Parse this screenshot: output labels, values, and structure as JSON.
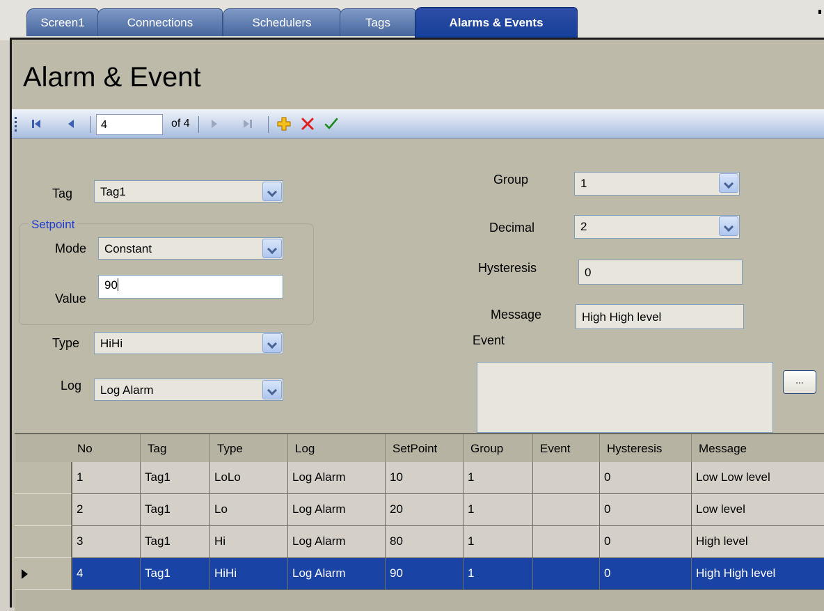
{
  "tabs": [
    {
      "label": "Screen1",
      "active": false
    },
    {
      "label": "Connections",
      "active": false
    },
    {
      "label": "Schedulers",
      "active": false
    },
    {
      "label": "Tags",
      "active": false
    },
    {
      "label": "Alarms & Events",
      "active": true
    }
  ],
  "page_title": "Alarm & Event",
  "navigator": {
    "position": "4",
    "count_text": "of 4",
    "icons": [
      "move-first-icon",
      "move-previous-icon",
      "move-next-icon",
      "move-last-icon",
      "add-new-icon",
      "delete-icon",
      "save-icon"
    ]
  },
  "form": {
    "tag": {
      "label": "Tag",
      "value": "Tag1"
    },
    "setpoint_legend": "Setpoint",
    "mode": {
      "label": "Mode",
      "value": "Constant"
    },
    "value": {
      "label": "Value",
      "value": "90"
    },
    "type": {
      "label": "Type",
      "value": "HiHi"
    },
    "log": {
      "label": "Log",
      "value": "Log Alarm"
    },
    "group": {
      "label": "Group",
      "value": "1"
    },
    "decimal": {
      "label": "Decimal",
      "value": "2"
    },
    "hysteresis": {
      "label": "Hysteresis",
      "value": "0"
    },
    "message": {
      "label": "Message",
      "value": "High High level"
    },
    "event": {
      "label": "Event",
      "value": "",
      "browse_label": "..."
    }
  },
  "grid": {
    "columns": [
      "No",
      "Tag",
      "Type",
      "Log",
      "SetPoint",
      "Group",
      "Event",
      "Hysteresis",
      "Message"
    ],
    "rows": [
      [
        "1",
        "Tag1",
        "LoLo",
        "Log Alarm",
        "10",
        "1",
        "",
        "0",
        "Low Low level"
      ],
      [
        "2",
        "Tag1",
        "Lo",
        "Log Alarm",
        "20",
        "1",
        "",
        "0",
        "Low level"
      ],
      [
        "3",
        "Tag1",
        "Hi",
        "Log Alarm",
        "80",
        "1",
        "",
        "0",
        "High level"
      ],
      [
        "4",
        "Tag1",
        "HiHi",
        "Log Alarm",
        "90",
        "1",
        "",
        "0",
        "High High level"
      ]
    ],
    "selected_row": 4
  },
  "colors": {
    "panel": "#bdbaa9",
    "tab": "#5a77b0",
    "tab_active": "#1f3f99",
    "selection": "#1a43a6",
    "legend_text": "#1f3bd1",
    "delete": "#e02020",
    "save": "#1a8a1a",
    "add": "#e8a800"
  }
}
